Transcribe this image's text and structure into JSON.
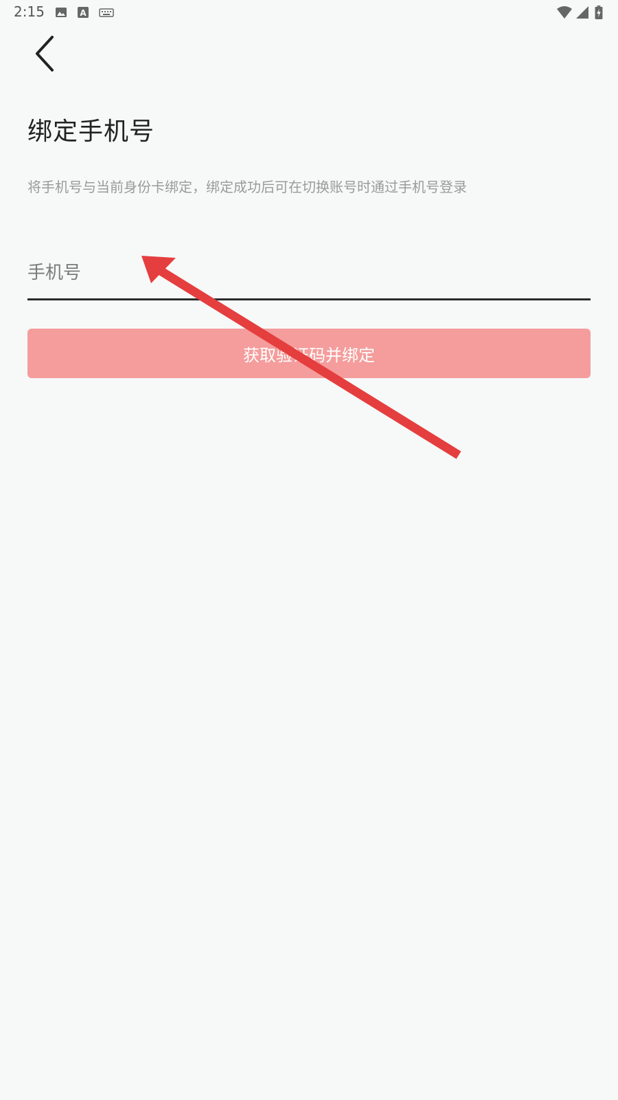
{
  "status_bar": {
    "time": "2:15",
    "icons": [
      "image-icon",
      "text-a-icon",
      "keyboard-icon",
      "wifi-icon",
      "signal-icon",
      "battery-charging-icon"
    ]
  },
  "header": {
    "back_icon": "chevron-left-icon",
    "title": "绑定手机号",
    "description": "将手机号与当前身份卡绑定，绑定成功后可在切换账号时通过手机号登录"
  },
  "form": {
    "phone_placeholder": "手机号",
    "phone_value": "",
    "submit_label": "获取验证码并绑定"
  },
  "colors": {
    "background": "#f7f8f8",
    "button": "#f49d9c",
    "arrow": "#e53e3e",
    "underline": "#2b2b2b"
  }
}
